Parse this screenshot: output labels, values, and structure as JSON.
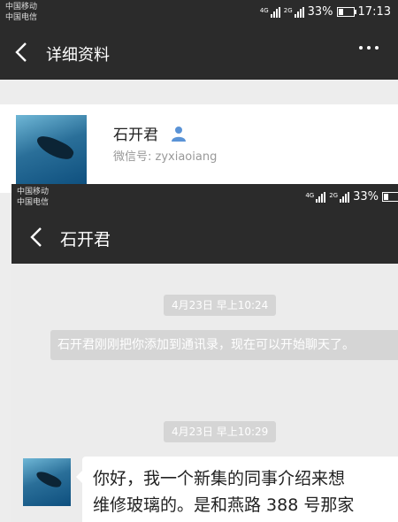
{
  "colors": {
    "header": "#2b2b2b",
    "background": "#ededed",
    "chip": "#d5d5d5",
    "accent_blue": "#4a90d9"
  },
  "bg": {
    "status": {
      "carrier1": "中国移动",
      "carrier2": "中国电信",
      "net1": "4G",
      "net2": "2G",
      "battery": "33%",
      "time": "17:13"
    },
    "nav": {
      "title": "详细资料",
      "back_icon": "chevron-left-icon",
      "more_icon": "more-icon"
    },
    "profile": {
      "name": "石开君",
      "wechat_id": "微信号: zyxiaoiang",
      "user_icon": "person-icon"
    }
  },
  "fg": {
    "status": {
      "carrier1": "中国移动",
      "carrier2": "中国电信",
      "net1": "4G",
      "net2": "2G",
      "battery": "33%"
    },
    "nav": {
      "title": "石开君",
      "back_icon": "chevron-left-icon"
    },
    "messages": {
      "time1": "4月23日 早上10:24",
      "system": "石开君刚刚把你添加到通讯录，现在可以开始聊天了。",
      "time2": "4月23日 早上10:29",
      "incoming": "你好，我一个新集的同事介绍来想\n维修玻璃的。是和燕路 388 号那家"
    }
  }
}
